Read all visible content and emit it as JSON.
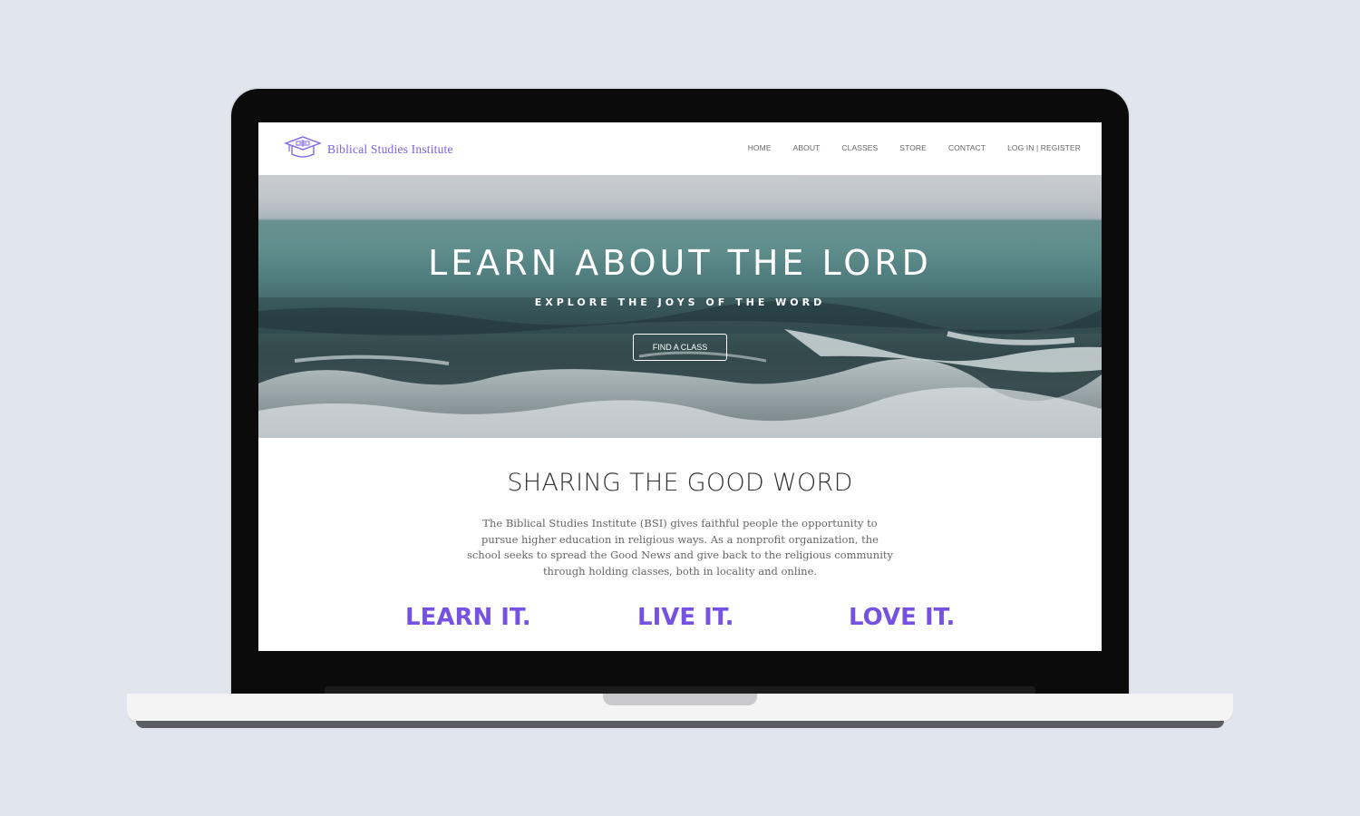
{
  "site": {
    "logo_text": "Biblical Studies Institute",
    "nav": [
      "HOME",
      "ABOUT",
      "CLASSES",
      "STORE",
      "CONTACT",
      "LOG IN | REGISTER"
    ]
  },
  "hero": {
    "title": "LEARN ABOUT THE LORD",
    "subtitle": "EXPLORE THE JOYS OF THE WORD",
    "button": "FIND A CLASS"
  },
  "about": {
    "title": "SHARING THE GOOD WORD",
    "body": "The Biblical Studies Institute (BSI) gives faithful people the opportunity to pursue higher education in religious ways. As a nonprofit organization, the school seeks to spread the Good News and give back to the religious community through holding classes, both in locality and online."
  },
  "taglines": [
    "LEARN IT.",
    "LIVE IT.",
    "LOVE IT."
  ],
  "colors": {
    "brand": "#7552e0",
    "background": "#e1e6ee"
  }
}
